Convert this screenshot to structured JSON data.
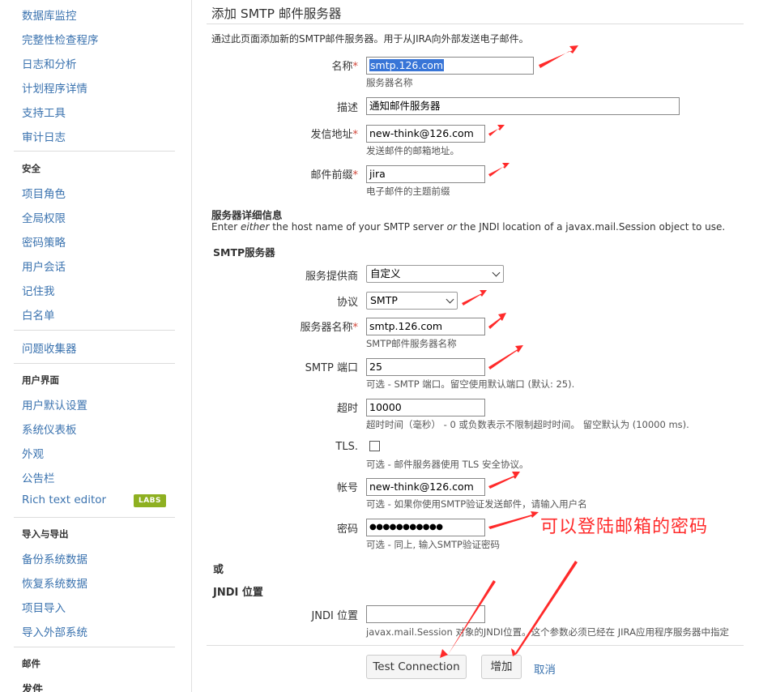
{
  "sidebar": {
    "items": [
      {
        "label": "数据库监控",
        "type": "link"
      },
      {
        "label": "完整性检查程序",
        "type": "link"
      },
      {
        "label": "日志和分析",
        "type": "link"
      },
      {
        "label": "计划程序详情",
        "type": "link"
      },
      {
        "label": "支持工具",
        "type": "link"
      },
      {
        "label": "审计日志",
        "type": "link"
      },
      {
        "label": "安全",
        "type": "heading"
      },
      {
        "label": "项目角色",
        "type": "link"
      },
      {
        "label": "全局权限",
        "type": "link"
      },
      {
        "label": "密码策略",
        "type": "link"
      },
      {
        "label": "用户会话",
        "type": "link"
      },
      {
        "label": "记住我",
        "type": "link"
      },
      {
        "label": "白名单",
        "type": "link"
      },
      {
        "label": "问题收集器",
        "type": "link"
      },
      {
        "label": "用户界面",
        "type": "heading"
      },
      {
        "label": "用户默认设置",
        "type": "link"
      },
      {
        "label": "系统仪表板",
        "type": "link"
      },
      {
        "label": "外观",
        "type": "link"
      },
      {
        "label": "公告栏",
        "type": "link"
      },
      {
        "label": "Rich text editor",
        "type": "link"
      },
      {
        "label": "导入与导出",
        "type": "heading"
      },
      {
        "label": "备份系统数据",
        "type": "link"
      },
      {
        "label": "恢复系统数据",
        "type": "link"
      },
      {
        "label": "项目导入",
        "type": "link"
      },
      {
        "label": "导入外部系统",
        "type": "link"
      },
      {
        "label": "邮件",
        "type": "heading"
      },
      {
        "label": "发件",
        "type": "heading"
      }
    ],
    "labs_badge": "LABS"
  },
  "form": {
    "title": "添加 SMTP 邮件服务器",
    "intro": "通过此页面添加新的SMTP邮件服务器。用于从JIRA向外部发送电子邮件。",
    "required_mark": "*",
    "name": {
      "label": "名称",
      "value": "smtp.126.com",
      "help": "服务器名称"
    },
    "description": {
      "label": "描述",
      "value": "通知邮件服务器"
    },
    "from": {
      "label": "发信地址",
      "value": "new-think@126.com",
      "help": "发送邮件的邮箱地址。"
    },
    "prefix": {
      "label": "邮件前缀",
      "value": "jira",
      "help": "电子邮件的主题前缀"
    },
    "server_details": {
      "heading": "服务器详细信息",
      "hint_pre": "Enter ",
      "hint_either": "either",
      "hint_mid": " the host name of your SMTP server ",
      "hint_or": "or",
      "hint_post": " the JNDI location of a javax.mail.Session object to use."
    },
    "smtp_heading": "SMTP服务器",
    "provider": {
      "label": "服务提供商",
      "value": "自定义"
    },
    "protocol": {
      "label": "协议",
      "value": "SMTP"
    },
    "host": {
      "label": "服务器名称",
      "value": "smtp.126.com",
      "help": "SMTP邮件服务器名称"
    },
    "port": {
      "label": "SMTP 端口",
      "value": "25",
      "help": "可选 - SMTP 端口。留空使用默认端口 (默认: 25)."
    },
    "timeout": {
      "label": "超时",
      "value": "10000",
      "help": "超时时间（毫秒） - 0 或负数表示不限制超时时间。 留空默认为 (10000 ms)."
    },
    "tls": {
      "label": "TLS.",
      "checked": false,
      "help": "可选 - 邮件服务器使用 TLS 安全协议。"
    },
    "username": {
      "label": "帐号",
      "value": "new-think@126.com",
      "help": "可选 - 如果你使用SMTP验证发送邮件，请输入用户名"
    },
    "password": {
      "label": "密码",
      "value": "●●●●●●●●●●●",
      "help": "可选 - 同上, 输入SMTP验证密码"
    },
    "password_note": "可以登陆邮箱的密码",
    "or_label": "或",
    "jndi_heading": "JNDI 位置",
    "jndi": {
      "label": "JNDI 位置",
      "value": "",
      "help": "javax.mail.Session 对象的JNDI位置。这个参数必须已经在 JIRA应用程序服务器中指定"
    },
    "buttons": {
      "test": "Test Connection",
      "add": "增加",
      "cancel": "取消"
    }
  },
  "colors": {
    "link": "#3b73af",
    "required": "#d04437",
    "annotation": "#ff2a2a",
    "labs": "#8eb021"
  }
}
